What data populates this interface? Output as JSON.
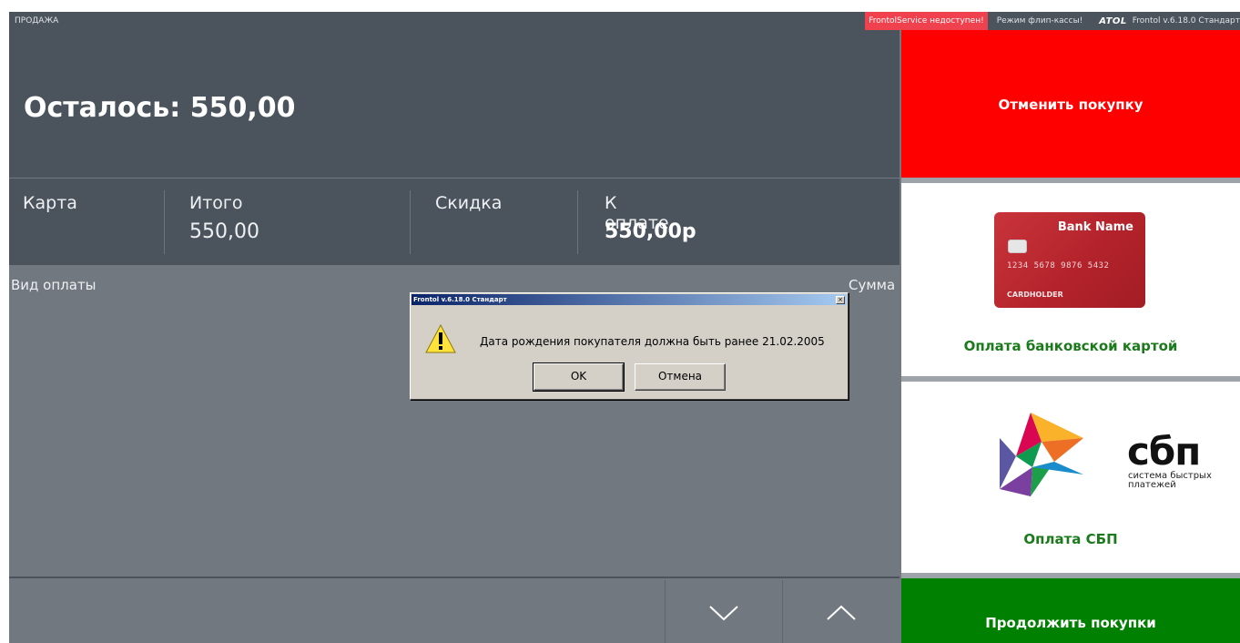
{
  "topbar": {
    "mode": "ПРОДАЖА",
    "service_status": "FrontolService недоступен!",
    "flip_mode": "Режим флип-кассы!",
    "logo": "ATOL",
    "version": "Frontol v.6.18.0 Стандарт"
  },
  "header": {
    "remaining": "Осталось: 550,00"
  },
  "totals": {
    "card_label": "Карта",
    "total_label": "Итого",
    "total_value": "550,00",
    "discount_label": "Скидка",
    "to_pay_label": "К оплате",
    "to_pay_value": "550,00р"
  },
  "payments": {
    "type_header": "Вид оплаты",
    "sum_header": "Сумма"
  },
  "right_panel": {
    "cancel_label": "Отменить покупку",
    "card_pay_label": "Оплата банковской картой",
    "sbp_pay_label": "Оплата СБП",
    "continue_label": "Продолжить покупки",
    "bank_card": {
      "bank_name": "Bank Name",
      "number": "1234 5678 9876 5432",
      "holder": "CARDHOLDER"
    },
    "sbp_logo": {
      "word": "сбп",
      "tagline_1": "система быстрых",
      "tagline_2": "платежей"
    }
  },
  "dialog": {
    "title": "Frontol v.6.18.0 Стандарт",
    "close_glyph": "×",
    "message": "Дата рождения покупателя должна быть ранее 21.02.2005",
    "ok_label": "OK",
    "cancel_label": "Отмена"
  },
  "colors": {
    "cancel": "#ff0000",
    "continue": "#008000",
    "pay_text": "#1b7a1b",
    "header_bg": "#4b545d",
    "body_bg": "#727880"
  }
}
